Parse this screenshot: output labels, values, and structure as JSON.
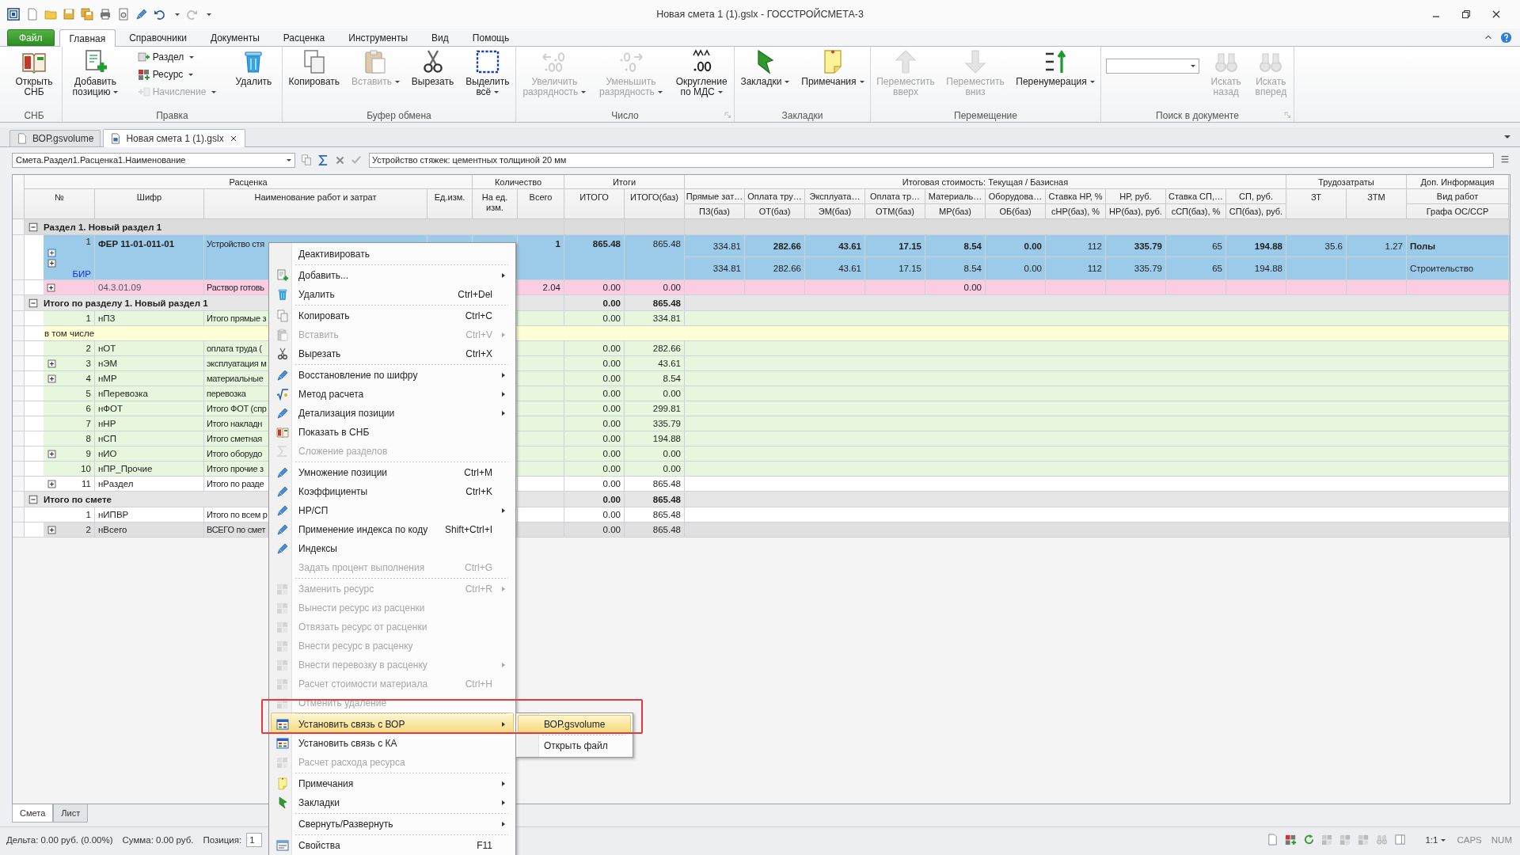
{
  "title_bar": {
    "title": "Новая смета 1 (1).gslx - ГОССТРОЙСМЕТА-3"
  },
  "ribbon": {
    "file_tab": "Файл",
    "tabs": [
      {
        "label": "Главная",
        "selected": true
      },
      {
        "label": "Справочники",
        "selected": false
      },
      {
        "label": "Документы",
        "selected": false
      },
      {
        "label": "Расценка",
        "selected": false
      },
      {
        "label": "Инструменты",
        "selected": false
      },
      {
        "label": "Вид",
        "selected": false
      },
      {
        "label": "Помощь",
        "selected": false
      }
    ],
    "groups": [
      {
        "label": "СНБ",
        "launcher": false,
        "controls": [
          {
            "kind": "large",
            "label": "Открыть\nСНБ",
            "dropdown": false,
            "disabled": false
          }
        ]
      },
      {
        "label": "Правка",
        "launcher": false,
        "controls": [
          {
            "kind": "large",
            "label": "Добавить\nпозицию",
            "dropdown": true,
            "disabled": false
          },
          {
            "kind": "stack",
            "items": [
              {
                "label": "Раздел",
                "dropdown": true,
                "disabled": false
              },
              {
                "label": "Ресурс",
                "dropdown": true,
                "disabled": false
              },
              {
                "label": "Начисление",
                "dropdown": true,
                "disabled": true
              }
            ]
          },
          {
            "kind": "large",
            "label": "Удалить",
            "dropdown": false,
            "disabled": false
          }
        ]
      },
      {
        "label": "Буфер обмена",
        "launcher": false,
        "controls": [
          {
            "kind": "large",
            "label": "Копировать",
            "dropdown": false,
            "disabled": false
          },
          {
            "kind": "large",
            "label": "Вставить",
            "dropdown": true,
            "disabled": true
          },
          {
            "kind": "large",
            "label": "Вырезать",
            "dropdown": false,
            "disabled": false
          },
          {
            "kind": "large",
            "label": "Выделить\nвсё",
            "dropdown": true,
            "disabled": false
          }
        ]
      },
      {
        "label": "Число",
        "launcher": true,
        "controls": [
          {
            "kind": "large",
            "label": "Увеличить\nразрядность",
            "dropdown": true,
            "disabled": true
          },
          {
            "kind": "large",
            "label": "Уменьшить\nразрядность",
            "dropdown": true,
            "disabled": true
          },
          {
            "kind": "large",
            "label": "Округление\nпо МДС",
            "dropdown": true,
            "disabled": false
          }
        ]
      },
      {
        "label": "Закладки",
        "launcher": false,
        "controls": [
          {
            "kind": "large",
            "label": "Закладки",
            "dropdown": true,
            "disabled": false
          },
          {
            "kind": "large",
            "label": "Примечания",
            "dropdown": true,
            "disabled": false
          }
        ]
      },
      {
        "label": "Перемещение",
        "launcher": false,
        "controls": [
          {
            "kind": "large",
            "label": "Переместить\nвверх",
            "dropdown": false,
            "disabled": true
          },
          {
            "kind": "large",
            "label": "Переместить\nвниз",
            "dropdown": false,
            "disabled": true
          },
          {
            "kind": "large",
            "label": "Перенумерация",
            "dropdown": true,
            "disabled": false
          }
        ]
      },
      {
        "label": "Поиск в документе",
        "launcher": true,
        "controls": [
          {
            "kind": "combo"
          },
          {
            "kind": "large",
            "label": "Искать\nназад",
            "dropdown": false,
            "disabled": true
          },
          {
            "kind": "large",
            "label": "Искать\nвперед",
            "dropdown": false,
            "disabled": true
          }
        ]
      }
    ]
  },
  "document_tabs": [
    {
      "label": "ВОР.gsvolume",
      "selected": false,
      "closable": false
    },
    {
      "label": "Новая смета 1 (1).gslx",
      "selected": true,
      "closable": true
    }
  ],
  "formula_bar": {
    "field_path": "Смета.Раздел1.Расценка1.Наименование",
    "value": "Устройство стяжек: цементных толщиной 20 мм"
  },
  "grid": {
    "column_groups": [
      {
        "label": "Расценка",
        "columns": [
          {
            "label": "№"
          },
          {
            "label": "Шифр"
          },
          {
            "label": "Наименование работ и затрат"
          },
          {
            "label": "Ед.изм."
          }
        ]
      },
      {
        "label": "Количество",
        "columns": [
          {
            "label": "На ед. изм."
          },
          {
            "label": "Всего"
          }
        ]
      },
      {
        "label": "Итоги",
        "columns": [
          {
            "label": "ИТОГО"
          },
          {
            "label": "ИТОГО(баз)"
          }
        ]
      },
      {
        "label": "Итоговая стоимость: Текущая / Базисная",
        "columns": [
          {
            "label": "Прямые зат…",
            "sublabel": "ПЗ(баз)"
          },
          {
            "label": "Оплата тру…",
            "sublabel": "ОТ(баз)"
          },
          {
            "label": "Эксплуата…",
            "sublabel": "ЭМ(баз)"
          },
          {
            "label": "Оплата тр…",
            "sublabel": "ОТМ(баз)"
          },
          {
            "label": "Материаль…",
            "sublabel": "МР(баз)"
          },
          {
            "label": "Оборудова…",
            "sublabel": "ОБ(баз)"
          },
          {
            "label": "Ставка НР, %",
            "sublabel": "сНР(баз), %"
          },
          {
            "label": "НР, руб.",
            "sublabel": "НР(баз), руб."
          },
          {
            "label": "Ставка СП,…",
            "sublabel": "сСП(баз), %"
          },
          {
            "label": "СП, руб.",
            "sublabel": "СП(баз), руб."
          }
        ]
      },
      {
        "label": "Трудозатраты",
        "columns": [
          {
            "label": "ЗТ"
          },
          {
            "label": "ЗТМ"
          }
        ]
      },
      {
        "label": "Доп. Информация",
        "columns": [
          {
            "label": "Вид работ",
            "sublabel": "Графа ОС/ССР"
          }
        ]
      }
    ],
    "rows": [
      {
        "kind": "group",
        "label": "Раздел 1. Новый раздел 1",
        "expanded": true,
        "color": "#dcdcdc"
      },
      {
        "kind": "position",
        "number": "1",
        "code": "ФЕР 11-01-011-01",
        "name": "Устройство стя",
        "total": "1",
        "itogo": "865.48",
        "itogo_base": "865.48",
        "current": [
          "334.81",
          "282.66",
          "43.61",
          "17.15",
          "8.54",
          "0.00",
          "112",
          "335.79",
          "65",
          "194.88"
        ],
        "base": [
          "334.81",
          "282.66",
          "43.61",
          "17.15",
          "8.54",
          "0.00",
          "112",
          "335.79",
          "65",
          "194.88"
        ],
        "labor": "35.6",
        "labor_machine": "1.27",
        "work_type": "Полы",
        "estimate_column": "Строительство",
        "marker": "БИР",
        "color": "#9ccbea"
      },
      {
        "kind": "resource",
        "code": "04.3.01.09",
        "name": "Раствор готовь",
        "total": "2.04",
        "itogo": "0.00",
        "itogo_base": "0.00",
        "material_base": "0.00",
        "expanded": false,
        "color": "#fbcde1"
      },
      {
        "kind": "group",
        "label": "Итого по разделу 1. Новый раздел 1",
        "expanded": true,
        "itogo": "0.00",
        "itogo_base": "865.48",
        "color": "#e6e6e6"
      },
      {
        "kind": "summary",
        "number": "1",
        "code": "нПЗ",
        "name": "Итого прямые з",
        "itogo": "0.00",
        "itogo_base": "334.81",
        "expandable": false,
        "color": "#e6f7dd"
      },
      {
        "kind": "note",
        "text": "в том числе",
        "color": "#ffffd6"
      },
      {
        "kind": "summary",
        "number": "2",
        "code": "нОТ",
        "name": "оплата труда (",
        "itogo": "0.00",
        "itogo_base": "282.66",
        "expandable": false,
        "color": "#e6f7dd"
      },
      {
        "kind": "summary",
        "number": "3",
        "code": "нЭМ",
        "name": "эксплуатация м",
        "itogo": "0.00",
        "itogo_base": "43.61",
        "expandable": true,
        "color": "#e6f7dd"
      },
      {
        "kind": "summary",
        "number": "4",
        "code": "нМР",
        "name": "материальные",
        "itogo": "0.00",
        "itogo_base": "8.54",
        "expandable": true,
        "color": "#e6f7dd"
      },
      {
        "kind": "summary",
        "number": "5",
        "code": "нПеревозка",
        "name": "перевозка",
        "itogo": "0.00",
        "itogo_base": "0.00",
        "expandable": false,
        "color": "#e6f7dd"
      },
      {
        "kind": "summary",
        "number": "6",
        "code": "нФОТ",
        "name": "Итого ФОТ (спр",
        "itogo": "0.00",
        "itogo_base": "299.81",
        "expandable": false,
        "color": "#e6f7dd"
      },
      {
        "kind": "summary",
        "number": "7",
        "code": "нНР",
        "name": "Итого накладн",
        "itogo": "0.00",
        "itogo_base": "335.79",
        "expandable": false,
        "color": "#e6f7dd"
      },
      {
        "kind": "summary",
        "number": "8",
        "code": "нСП",
        "name": "Итого сметная",
        "itogo": "0.00",
        "itogo_base": "194.88",
        "expandable": false,
        "color": "#e6f7dd"
      },
      {
        "kind": "summary",
        "number": "9",
        "code": "нИО",
        "name": "Итого оборудо",
        "itogo": "0.00",
        "itogo_base": "0.00",
        "expandable": true,
        "color": "#e6f7dd"
      },
      {
        "kind": "summary",
        "number": "10",
        "code": "нПР_Прочие",
        "name": "Итого прочие з",
        "itogo": "0.00",
        "itogo_base": "0.00",
        "expandable": false,
        "color": "#e6f7dd"
      },
      {
        "kind": "summary",
        "number": "11",
        "code": "нРаздел",
        "name": "Итого по разде",
        "itogo": "0.00",
        "itogo_base": "865.48",
        "expandable": true,
        "color": "#ffffff"
      },
      {
        "kind": "group",
        "label": "Итого по смете",
        "expanded": true,
        "itogo": "0.00",
        "itogo_base": "865.48",
        "color": "#e6e6e6"
      },
      {
        "kind": "summary",
        "number": "1",
        "code": "нИПВР",
        "name": "Итого по всем р",
        "itogo": "0.00",
        "itogo_base": "865.48",
        "expandable": false,
        "color": "#ffffff"
      },
      {
        "kind": "summary",
        "number": "2",
        "code": "нВсего",
        "name": "ВСЕГО по смет",
        "itogo": "0.00",
        "itogo_base": "865.48",
        "expandable": true,
        "color": "#e0e0e0"
      }
    ]
  },
  "sheet_tabs": [
    {
      "label": "Смета",
      "selected": true
    },
    {
      "label": "Лист",
      "selected": false
    }
  ],
  "status_bar": {
    "delta": "Дельта: 0.00 руб. (0.00%)",
    "sum": "Сумма: 0.00 руб.",
    "position_label": "Позиция:",
    "position_value": "1",
    "zoom": "1:1",
    "indicators": [
      {
        "label": "CAPS",
        "on": false
      },
      {
        "label": "NUM",
        "on": false
      }
    ]
  },
  "context_menu": {
    "items": [
      {
        "label": "Деактивировать",
        "disabled": false,
        "selected": false,
        "separator_before": false,
        "has_submenu": false
      },
      {
        "label": "Добавить...",
        "disabled": false,
        "selected": false,
        "separator_before": true,
        "has_submenu": true
      },
      {
        "label": "Удалить",
        "shortcut": "Ctrl+Del",
        "disabled": false,
        "selected": false,
        "separator_before": false,
        "has_submenu": false
      },
      {
        "label": "Копировать",
        "shortcut": "Ctrl+C",
        "disabled": false,
        "selected": false,
        "separator_before": true,
        "has_submenu": false
      },
      {
        "label": "Вставить",
        "shortcut": "Ctrl+V",
        "disabled": true,
        "selected": false,
        "separator_before": false,
        "has_submenu": true
      },
      {
        "label": "Вырезать",
        "shortcut": "Ctrl+X",
        "disabled": false,
        "selected": false,
        "separator_before": false,
        "has_submenu": false
      },
      {
        "label": "Восстановление по шифру",
        "disabled": false,
        "selected": false,
        "separator_before": true,
        "has_submenu": true
      },
      {
        "label": "Метод расчета",
        "disabled": false,
        "selected": false,
        "separator_before": false,
        "has_submenu": true
      },
      {
        "label": "Детализация позиции",
        "disabled": false,
        "selected": false,
        "separator_before": false,
        "has_submenu": true
      },
      {
        "label": "Показать в СНБ",
        "disabled": false,
        "selected": false,
        "separator_before": false,
        "has_submenu": false
      },
      {
        "label": "Сложение разделов",
        "disabled": true,
        "selected": false,
        "separator_before": false,
        "has_submenu": false
      },
      {
        "label": "Умножение позиции",
        "shortcut": "Ctrl+M",
        "disabled": false,
        "selected": false,
        "separator_before": true,
        "has_submenu": false
      },
      {
        "label": "Коэффициенты",
        "shortcut": "Ctrl+K",
        "disabled": false,
        "selected": false,
        "separator_before": false,
        "has_submenu": false
      },
      {
        "label": "НР/СП",
        "disabled": false,
        "selected": false,
        "separator_before": false,
        "has_submenu": true
      },
      {
        "label": "Применение индекса по коду",
        "shortcut": "Shift+Ctrl+I",
        "disabled": false,
        "selected": false,
        "separator_before": false,
        "has_submenu": false
      },
      {
        "label": "Индексы",
        "disabled": false,
        "selected": false,
        "separator_before": false,
        "has_submenu": false
      },
      {
        "label": "Задать процент выполнения",
        "shortcut": "Ctrl+G",
        "disabled": true,
        "selected": false,
        "separator_before": false,
        "has_submenu": false
      },
      {
        "label": "Заменить ресурс",
        "shortcut": "Ctrl+R",
        "disabled": true,
        "selected": false,
        "separator_before": true,
        "has_submenu": true
      },
      {
        "label": "Вынести ресурс из расценки",
        "disabled": true,
        "selected": false,
        "separator_before": false,
        "has_submenu": false
      },
      {
        "label": "Отвязать ресурс от расценки",
        "disabled": true,
        "selected": false,
        "separator_before": false,
        "has_submenu": false
      },
      {
        "label": "Внести ресурс в расценку",
        "disabled": true,
        "selected": false,
        "separator_before": false,
        "has_submenu": false
      },
      {
        "label": "Внести перевозку в расценку",
        "disabled": true,
        "selected": false,
        "separator_before": false,
        "has_submenu": true
      },
      {
        "label": "Расчет стоимости материала",
        "shortcut": "Ctrl+H",
        "disabled": true,
        "selected": false,
        "separator_before": false,
        "has_submenu": false
      },
      {
        "label": "Отменить удаление",
        "disabled": true,
        "selected": false,
        "separator_before": false,
        "has_submenu": false
      },
      {
        "label": "Установить связь с ВОР",
        "disabled": false,
        "selected": true,
        "separator_before": true,
        "has_submenu": true,
        "submenu": [
          {
            "label": "ВОР.gsvolume",
            "selected": true,
            "separator_before": false
          },
          {
            "label": "Открыть файл",
            "selected": false,
            "separator_before": true
          }
        ]
      },
      {
        "label": "Установить связь с КА",
        "disabled": false,
        "selected": false,
        "separator_before": false,
        "has_submenu": false
      },
      {
        "label": "Расчет расхода ресурса",
        "disabled": true,
        "selected": false,
        "separator_before": false,
        "has_submenu": false
      },
      {
        "label": "Примечания",
        "disabled": false,
        "selected": false,
        "separator_before": true,
        "has_submenu": true
      },
      {
        "label": "Закладки",
        "disabled": false,
        "selected": false,
        "separator_before": false,
        "has_submenu": true
      },
      {
        "label": "Свернуть/Развернуть",
        "disabled": false,
        "selected": false,
        "separator_before": true,
        "has_submenu": true
      },
      {
        "label": "Свойства",
        "shortcut": "F11",
        "disabled": false,
        "selected": false,
        "separator_before": true,
        "has_submenu": false
      }
    ]
  }
}
